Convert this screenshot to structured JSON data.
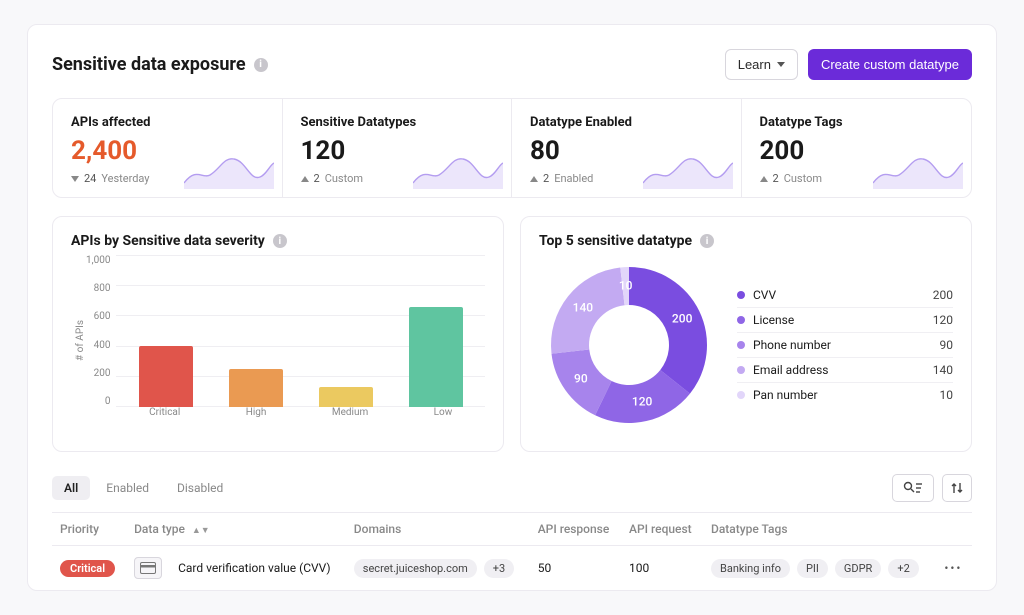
{
  "header": {
    "title": "Sensitive data exposure",
    "learn_label": "Learn",
    "create_label": "Create custom datatype"
  },
  "kpi": [
    {
      "label": "APIs affected",
      "value": "2,400",
      "accent": true,
      "delta_dir": "down",
      "delta_num": "24",
      "delta_suffix": "Yesterday"
    },
    {
      "label": "Sensitive Datatypes",
      "value": "120",
      "accent": false,
      "delta_dir": "up",
      "delta_num": "2",
      "delta_suffix": "Custom"
    },
    {
      "label": "Datatype Enabled",
      "value": "80",
      "accent": false,
      "delta_dir": "up",
      "delta_num": "2",
      "delta_suffix": "Enabled"
    },
    {
      "label": "Datatype Tags",
      "value": "200",
      "accent": false,
      "delta_dir": "up",
      "delta_num": "2",
      "delta_suffix": "Custom"
    }
  ],
  "bar_card": {
    "title": "APIs by Sensitive data severity",
    "y_label": "# of APIs"
  },
  "donut_card": {
    "title": "Top 5 sensitive datatype"
  },
  "chart_data": [
    {
      "type": "bar",
      "title": "APIs by Sensitive data severity",
      "ylabel": "# of APIs",
      "ylim": [
        0,
        1000
      ],
      "y_ticks": [
        "1,000",
        "800",
        "600",
        "400",
        "200",
        "0"
      ],
      "categories": [
        "Critical",
        "High",
        "Medium",
        "Low"
      ],
      "values": [
        400,
        250,
        130,
        660
      ],
      "colors": [
        "#e0554b",
        "#ea9a52",
        "#ebc960",
        "#5fc5a0"
      ]
    },
    {
      "type": "pie",
      "title": "Top 5 sensitive datatype",
      "series": [
        {
          "name": "CVV",
          "value": 200,
          "color": "#7a4de0"
        },
        {
          "name": "License",
          "value": 120,
          "color": "#8f66e6"
        },
        {
          "name": "Phone number",
          "value": 90,
          "color": "#a784ec"
        },
        {
          "name": "Email address",
          "value": 140,
          "color": "#c3aaf2"
        },
        {
          "name": "Pan number",
          "value": 10,
          "color": "#e2d6fa"
        }
      ]
    }
  ],
  "table": {
    "tabs": [
      "All",
      "Enabled",
      "Disabled"
    ],
    "columns": {
      "priority": "Priority",
      "datatype": "Data type",
      "domains": "Domains",
      "api_response": "API response",
      "api_request": "API request",
      "tags": "Datatype Tags"
    },
    "rows": [
      {
        "priority": "Critical",
        "datatype": "Card verification value (CVV)",
        "domain": "secret.juiceshop.com",
        "domain_extra": "+3",
        "api_response": "50",
        "api_request": "100",
        "tags": [
          "Banking info",
          "PII",
          "GDPR"
        ],
        "tags_extra": "+2"
      }
    ]
  }
}
